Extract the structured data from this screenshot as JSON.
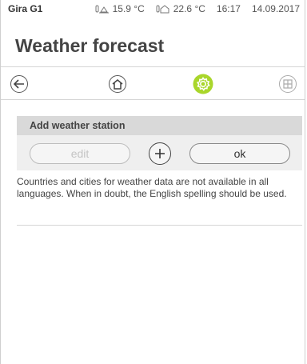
{
  "status": {
    "device": "Gira G1",
    "outdoor_temp": "15.9 °C",
    "indoor_temp": "22.6 °C",
    "time": "16:17",
    "date": "14.09.2017"
  },
  "title": "Weather forecast",
  "nav": {
    "back_icon": "arrow-left-icon",
    "home_icon": "home-icon",
    "settings_icon": "gear-icon",
    "grid_icon": "grid-icon",
    "accent": "#a9d62b"
  },
  "section": {
    "header": "Add weather station",
    "edit_label": "edit",
    "ok_label": "ok",
    "info": "Countries and cities for weather data are not available in all languages. When in doubt, the English spelling should be used."
  }
}
